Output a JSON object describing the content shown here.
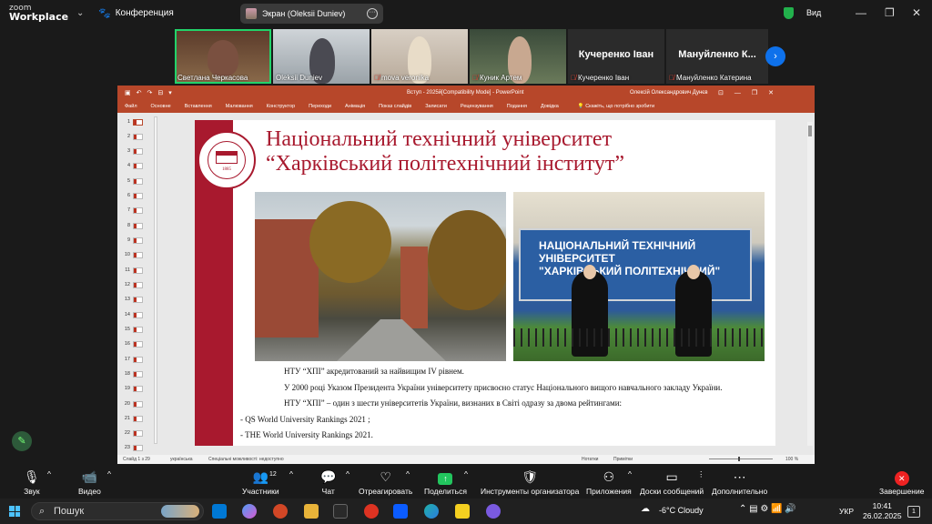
{
  "zoom": {
    "logo_line1": "zoom",
    "logo_line2": "Workplace",
    "meeting_label": "Конференция",
    "share_label": "Экран (Oleksii Duniev)",
    "view_label": "Вид"
  },
  "participants": [
    {
      "name": "Светлана Черкасова",
      "muted": false,
      "active": true
    },
    {
      "name": "Oleksii Duniev",
      "muted": false,
      "active": false
    },
    {
      "name": "mova veronika",
      "muted": true,
      "active": false
    },
    {
      "name": "Куник Артем",
      "muted": true,
      "active": false
    },
    {
      "name": "Кучеренко Іван",
      "big": "Кучеренко Іван",
      "muted": true,
      "active": false
    },
    {
      "name": "Мануйленко Катерина",
      "big": "Мануйленко К...",
      "muted": true,
      "active": false
    }
  ],
  "ppt": {
    "doc_title": "Вступ - 2025й[Compatibility Mode] - PowerPoint",
    "user": "Олексій Олександрович Дунєв",
    "menu": [
      "Файл",
      "Основне",
      "Вставлення",
      "Малювання",
      "Конструктор",
      "Переходи",
      "Анімація",
      "Показ слайдів",
      "Записати",
      "Рецензування",
      "Подання",
      "Довідка"
    ],
    "tell_me": "Скажіть, що потрібно зробити",
    "status_slide": "Слайд 1 з 29",
    "status_lang": "українська",
    "status_access": "Спеціальні можливості: недоступно",
    "status_notes": "Нотатки",
    "status_comments": "Примітки",
    "status_zoom": "100 %"
  },
  "slide": {
    "title_line1": "Національний технічний університет",
    "title_line2": "“Харківський політехнічний інститут”",
    "seal_year": "1885",
    "sign_line1": "НАЦІОНАЛЬНИЙ ТЕХНІЧНИЙ УНІВЕРСИТЕТ",
    "sign_line2": "\"ХАРКІВСЬКИЙ ПОЛІТЕХНІЧНИЙ\"",
    "text1": "НТУ “ХПІ” акредитований за найвищим IV рівнем.",
    "text2": "У 2000 році Указом Президента України університету присвоєно статус Національного вищого навчального закладу України.",
    "text3": "НТУ “ХПІ” – один з шести університетів України, визнаних в Світі одразу за двома рейтингами:",
    "text4": "- QS World University Rankings 2021 ;",
    "text5": "- THE World University Rankings 2021."
  },
  "toolbar": {
    "audio": "Звук",
    "video": "Видео",
    "participants": "Участники",
    "participants_count": "12",
    "chat": "Чат",
    "react": "Отреагировать",
    "share": "Поделиться",
    "host_tools": "Инструменты организатора",
    "apps": "Приложения",
    "whiteboards": "Доски сообщений",
    "more": "Дополнительно",
    "end": "Завершение"
  },
  "taskbar": {
    "search": "Пошук",
    "weather": "-6°C Cloudy",
    "lang": "УКР",
    "time": "10:41",
    "date": "26.02.2025",
    "notif_count": "1"
  }
}
